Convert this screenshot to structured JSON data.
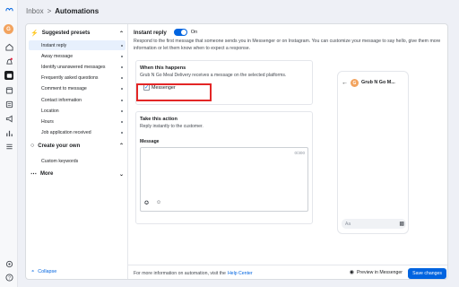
{
  "topbar": {
    "crumb": "Inbox",
    "separator": ">",
    "title": "Automations"
  },
  "rail": {
    "avatar_letter": "G",
    "icons": [
      "meta-logo-icon",
      "home-icon",
      "notification-icon",
      "inbox-icon",
      "calendar-icon",
      "posts-icon",
      "megaphone-icon",
      "insights-icon",
      "menu-icon",
      "settings-icon",
      "help-icon"
    ]
  },
  "sidebar": {
    "suggested_title": "Suggested presets",
    "items": [
      {
        "label": "Instant reply",
        "active": true,
        "dot": true
      },
      {
        "label": "Away message",
        "active": false,
        "dot": true
      },
      {
        "label": "Identify unanswered messages",
        "active": false,
        "dot": true
      },
      {
        "label": "Frequently asked questions",
        "active": false,
        "dot": true
      },
      {
        "label": "Comment to message",
        "active": false,
        "dot": true
      },
      {
        "label": "Contact information",
        "active": false,
        "dot": true
      },
      {
        "label": "Location",
        "active": false,
        "dot": true
      },
      {
        "label": "Hours",
        "active": false,
        "dot": true
      },
      {
        "label": "Job application received",
        "active": false,
        "dot": true
      }
    ],
    "own_title": "Create your own",
    "own_items": [
      {
        "label": "Custom keywords"
      }
    ],
    "more_title": "More",
    "collapse_label": "Collapse"
  },
  "main": {
    "title": "Instant reply",
    "toggle_label": "On",
    "toggle_on": true,
    "description": "Respond to the first message that someone sends you in Messenger or on Instagram. You can customize your message to say hello, give them more information or let them know when to expect a response.",
    "when": {
      "title": "When this happens",
      "subtitle": "Grub N Go Meal Delivery receives a message on the selected platforms.",
      "platform_label": "Messenger",
      "platform_checked": true
    },
    "action": {
      "title": "Take this action",
      "subtitle": "Reply instantly to the customer.",
      "message_label": "Message",
      "counter": "0/300"
    },
    "preview": {
      "avatar_letter": "G",
      "name": "Grub N Go M...",
      "input_placeholder": "Aa"
    }
  },
  "footer": {
    "info_text": "For more information on automation, visit the",
    "help_link": "Help Center",
    "preview_label": "Preview in Messenger",
    "save_label": "Save changes"
  },
  "colors": {
    "accent": "#0064e0",
    "highlight": "#e32626",
    "avatar": "#f2a35e"
  }
}
